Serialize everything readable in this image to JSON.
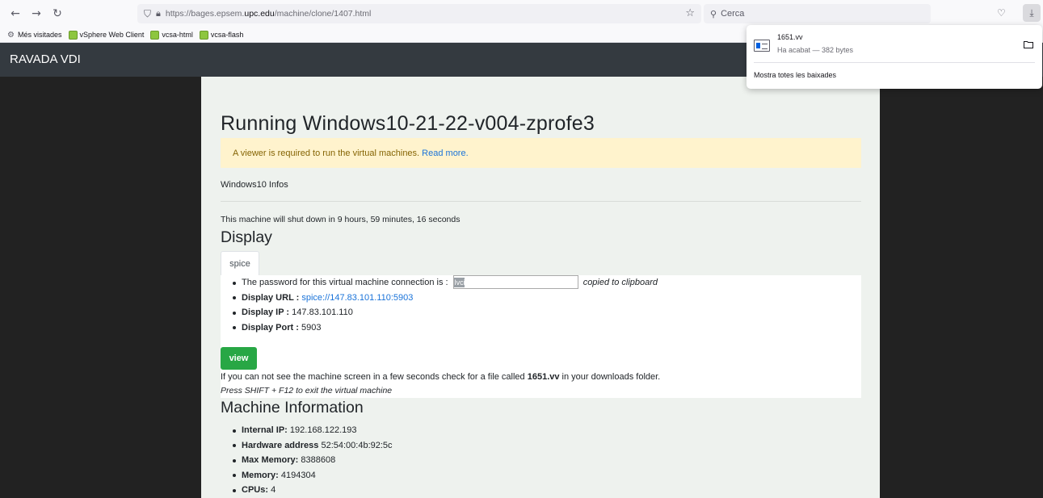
{
  "browser": {
    "nav": {
      "back": "←",
      "forward": "→",
      "reload": "↻"
    },
    "url": {
      "prefix": "https://bages.epsem.",
      "domain": "upc.edu",
      "path": "/machine/clone/1407.html"
    },
    "search_placeholder": "Cerca",
    "bookmarks": [
      "Més visitades",
      "vSphere Web Client",
      "vcsa-html",
      "vcsa-flash"
    ]
  },
  "downloads": {
    "file_name": "1651.vv",
    "status": "Ha acabat — 382 bytes",
    "show_all": "Mostra totes les baixades"
  },
  "app": {
    "brand": "RAVADA VDI"
  },
  "page": {
    "title": "Running Windows10-21-22-v004-zprofe3",
    "alert": {
      "text": "A viewer is required to run the virtual machines.",
      "link": "Read more."
    },
    "infos_title": "Windows10 Infos",
    "shutdown_text": "This machine will shut down in 9 hours, 59 minutes, 16 seconds",
    "display_title": "Display",
    "tab_label": "spice",
    "display": {
      "password_label": "The password for this virtual machine connection is :",
      "password_value": "lvci",
      "copied": "copied to clipboard",
      "url_label": "Display URL :",
      "url_value": "spice://147.83.101.110:5903",
      "ip_label": "Display IP :",
      "ip_value": "147.83.101.110",
      "port_label": "Display Port :",
      "port_value": "5903"
    },
    "view_button": "view",
    "hint": {
      "before": "If you can not see the machine screen in a few seconds check for a file called",
      "file": "1651.vv",
      "after": "in your downloads folder."
    },
    "press_hint": "Press SHIFT + F12 to exit the virtual machine",
    "machine_info_title": "Machine Information",
    "machine_info": [
      {
        "label": "Internal IP:",
        "value": "192.168.122.193"
      },
      {
        "label": "Hardware address",
        "value": "52:54:00:4b:92:5c"
      },
      {
        "label": "Max Memory:",
        "value": "8388608"
      },
      {
        "label": "Memory:",
        "value": "4194304"
      },
      {
        "label": "CPUs:",
        "value": "4"
      }
    ]
  }
}
